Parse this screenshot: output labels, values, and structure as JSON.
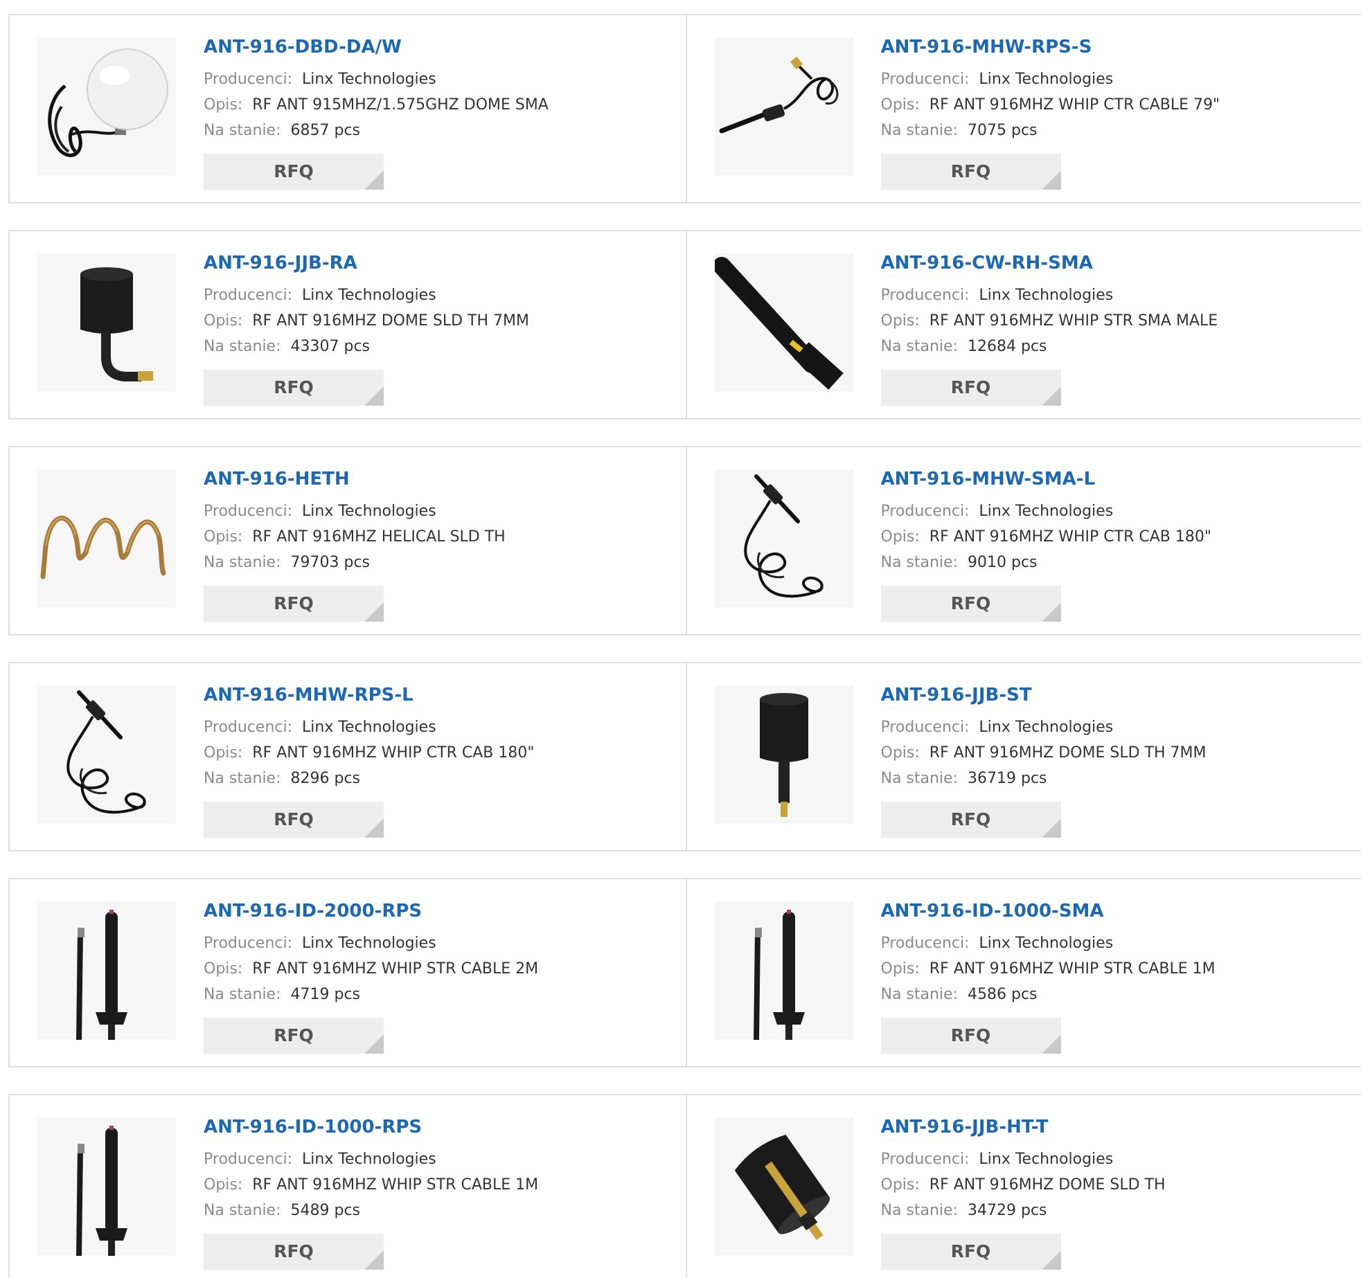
{
  "labels": {
    "manufacturer": "Producenci:",
    "description": "Opis:",
    "stock": "Na stanie:",
    "rfq": "RFQ"
  },
  "colors": {
    "title_link": "#1d68b3",
    "label": "#8a8a8a",
    "value": "#333333",
    "button_bg": "#ededed",
    "border": "#dcdcdc"
  },
  "products": [
    {
      "name": "ANT-916-DBD-DA/W",
      "manufacturer": "Linx Technologies",
      "description": "RF ANT 915MHZ/1.575GHZ DOME SMA",
      "stock": "6857 pcs",
      "image": "white-dome-antenna"
    },
    {
      "name": "ANT-916-MHW-RPS-S",
      "manufacturer": "Linx Technologies",
      "description": "RF ANT 916MHZ WHIP CTR CABLE 79\"",
      "stock": "7075 pcs",
      "image": "cable-whip-antenna"
    },
    {
      "name": "ANT-916-JJB-RA",
      "manufacturer": "Linx Technologies",
      "description": "RF ANT 916MHZ DOME SLD TH 7MM",
      "stock": "43307 pcs",
      "image": "right-angle-dome-antenna"
    },
    {
      "name": "ANT-916-CW-RH-SMA",
      "manufacturer": "Linx Technologies",
      "description": "RF ANT 916MHZ WHIP STR SMA MALE",
      "stock": "12684 pcs",
      "image": "black-whip-antenna"
    },
    {
      "name": "ANT-916-HETH",
      "manufacturer": "Linx Technologies",
      "description": "RF ANT 916MHZ HELICAL SLD TH",
      "stock": "79703 pcs",
      "image": "helical-antenna"
    },
    {
      "name": "ANT-916-MHW-SMA-L",
      "manufacturer": "Linx Technologies",
      "description": "RF ANT 916MHZ WHIP CTR CAB 180\"",
      "stock": "9010 pcs",
      "image": "cable-whip-antenna-coiled"
    },
    {
      "name": "ANT-916-MHW-RPS-L",
      "manufacturer": "Linx Technologies",
      "description": "RF ANT 916MHZ WHIP CTR CAB 180\"",
      "stock": "8296 pcs",
      "image": "cable-whip-antenna-coiled"
    },
    {
      "name": "ANT-916-JJB-ST",
      "manufacturer": "Linx Technologies",
      "description": "RF ANT 916MHZ DOME SLD TH 7MM",
      "stock": "36719 pcs",
      "image": "straight-dome-antenna"
    },
    {
      "name": "ANT-916-ID-2000-RPS",
      "manufacturer": "Linx Technologies",
      "description": "RF ANT 916MHZ WHIP STR CABLE 2M",
      "stock": "4719 pcs",
      "image": "mount-whip-antenna"
    },
    {
      "name": "ANT-916-ID-1000-SMA",
      "manufacturer": "Linx Technologies",
      "description": "RF ANT 916MHZ WHIP STR CABLE 1M",
      "stock": "4586 pcs",
      "image": "mount-whip-antenna"
    },
    {
      "name": "ANT-916-ID-1000-RPS",
      "manufacturer": "Linx Technologies",
      "description": "RF ANT 916MHZ WHIP STR CABLE 1M",
      "stock": "5489 pcs",
      "image": "mount-whip-antenna"
    },
    {
      "name": "ANT-916-JJB-HT-T",
      "manufacturer": "Linx Technologies",
      "description": "RF ANT 916MHZ DOME SLD TH",
      "stock": "34729 pcs",
      "image": "tilted-dome-antenna"
    }
  ]
}
